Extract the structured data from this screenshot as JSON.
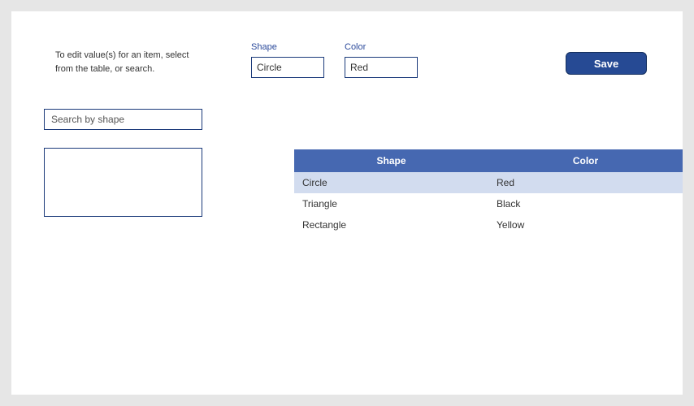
{
  "instructions": "To edit value(s) for an item, select from the table, or search.",
  "fields": {
    "shape": {
      "label": "Shape",
      "value": "Circle"
    },
    "color": {
      "label": "Color",
      "value": "Red"
    }
  },
  "actions": {
    "save_label": "Save"
  },
  "search": {
    "placeholder": "Search by shape",
    "value": ""
  },
  "table": {
    "headers": {
      "shape": "Shape",
      "color": "Color"
    },
    "rows": [
      {
        "shape": "Circle",
        "color": "Red",
        "selected": true
      },
      {
        "shape": "Triangle",
        "color": "Black",
        "selected": false
      },
      {
        "shape": "Rectangle",
        "color": "Yellow",
        "selected": false
      }
    ]
  }
}
